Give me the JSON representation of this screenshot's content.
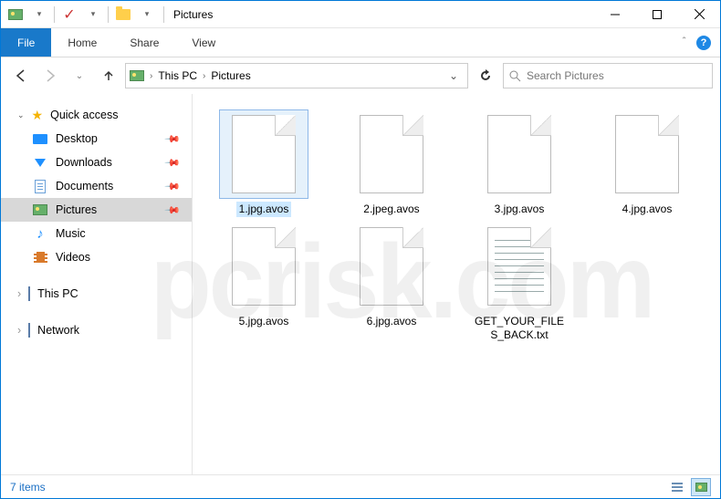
{
  "window": {
    "title": "Pictures"
  },
  "ribbon": {
    "file": "File",
    "tabs": [
      "Home",
      "Share",
      "View"
    ]
  },
  "breadcrumb": {
    "items": [
      "This PC",
      "Pictures"
    ]
  },
  "search": {
    "placeholder": "Search Pictures"
  },
  "sidebar": {
    "quick_access": "Quick access",
    "items": [
      {
        "label": "Desktop",
        "icon": "desktop",
        "pinned": true
      },
      {
        "label": "Downloads",
        "icon": "downloads",
        "pinned": true
      },
      {
        "label": "Documents",
        "icon": "documents",
        "pinned": true
      },
      {
        "label": "Pictures",
        "icon": "pictures",
        "pinned": true,
        "selected": true
      },
      {
        "label": "Music",
        "icon": "music",
        "pinned": false
      },
      {
        "label": "Videos",
        "icon": "videos",
        "pinned": false
      }
    ],
    "this_pc": "This PC",
    "network": "Network"
  },
  "files": [
    {
      "name": "1.jpg.avos",
      "type": "blank",
      "selected": true
    },
    {
      "name": "2.jpeg.avos",
      "type": "blank"
    },
    {
      "name": "3.jpg.avos",
      "type": "blank"
    },
    {
      "name": "4.jpg.avos",
      "type": "blank"
    },
    {
      "name": "5.jpg.avos",
      "type": "blank"
    },
    {
      "name": "6.jpg.avos",
      "type": "blank"
    },
    {
      "name": "GET_YOUR_FILES_BACK.txt",
      "type": "txt"
    }
  ],
  "status": {
    "count_label": "7 items"
  },
  "watermark": "pcrisk.com"
}
